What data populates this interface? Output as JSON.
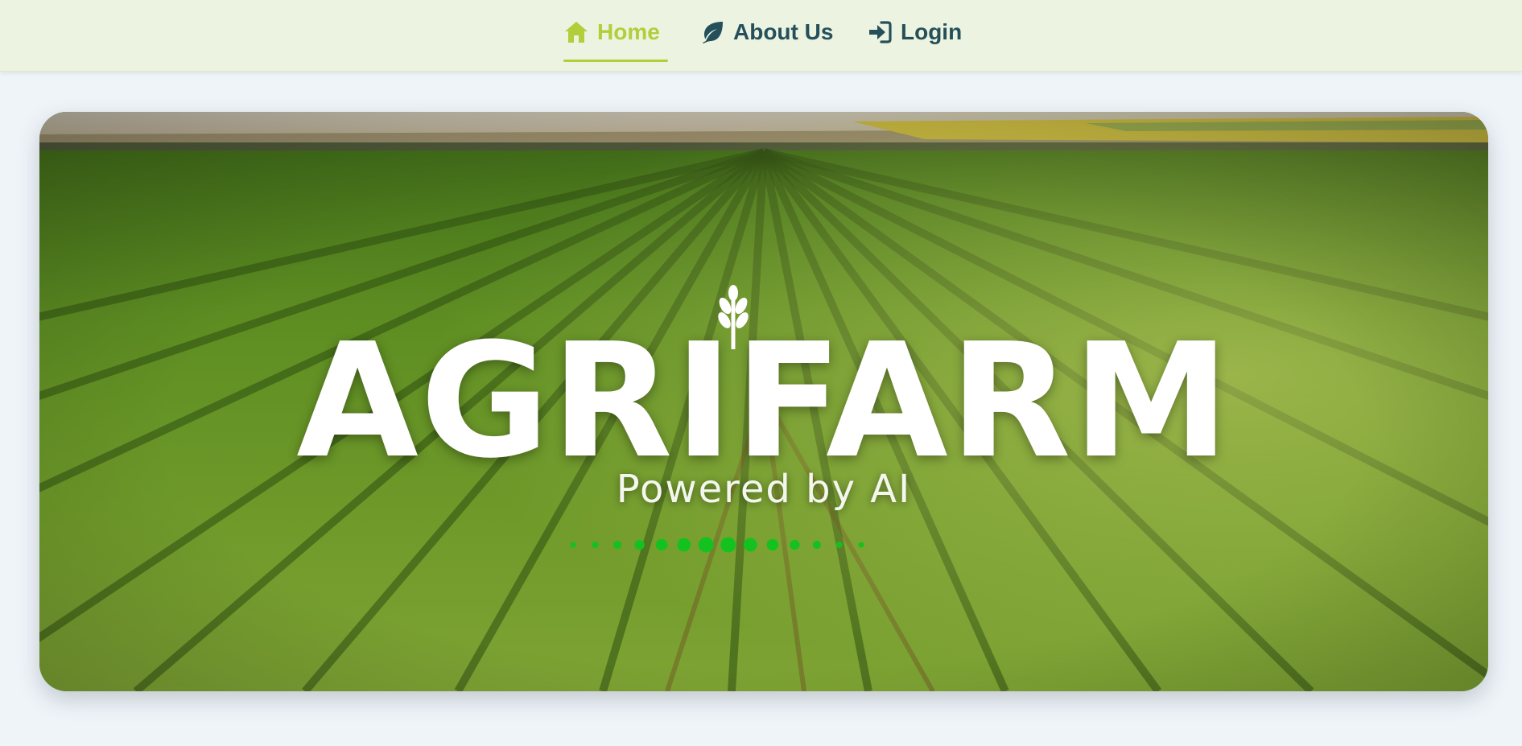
{
  "nav": {
    "items": [
      {
        "label": "Home",
        "icon": "home-icon",
        "active": true
      },
      {
        "label": "About Us",
        "icon": "leaf-icon",
        "active": false
      },
      {
        "label": "Login",
        "icon": "sign-in-icon",
        "active": false
      }
    ]
  },
  "hero": {
    "logo_text": "AGRIFARM",
    "tagline": "Powered by AI",
    "logo_icon": "wheat-icon",
    "loader_dots": 14,
    "colors": {
      "accent": "#b4cd3a",
      "nav_text": "#25505b",
      "nav_bg": "#ecf3e0",
      "loader": "#13c21f"
    }
  }
}
